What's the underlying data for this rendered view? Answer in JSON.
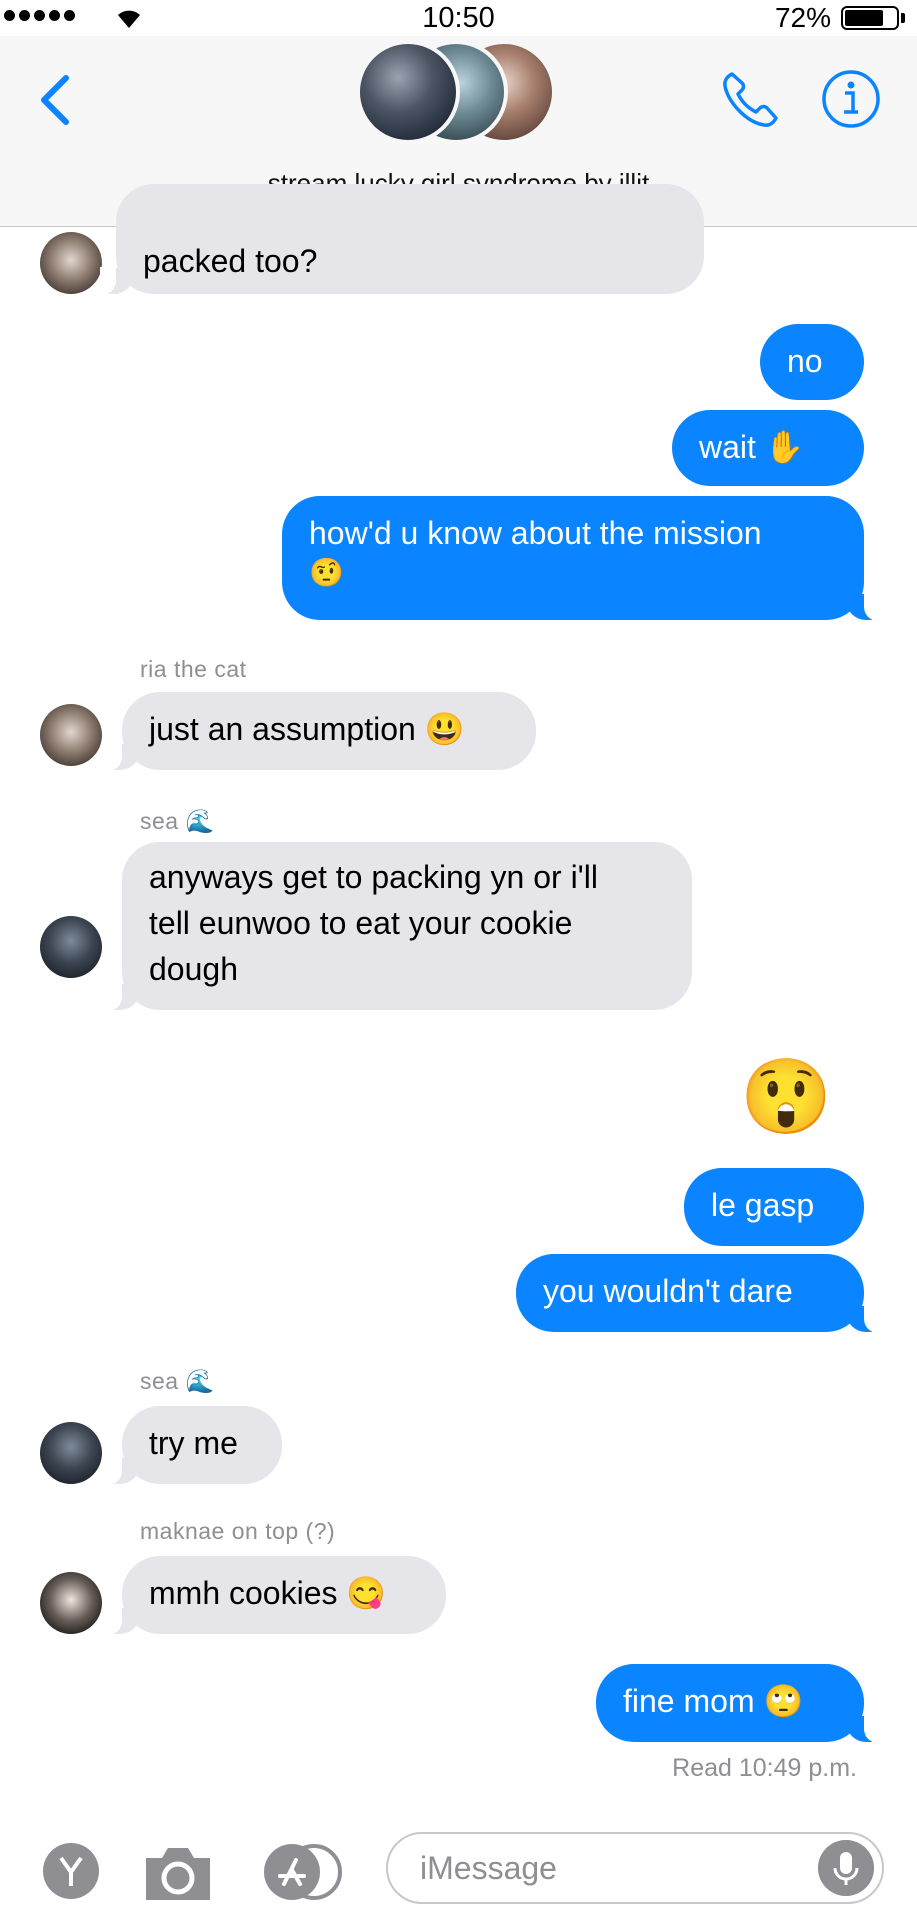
{
  "status_bar": {
    "time": "10:50",
    "battery_percent": "72%"
  },
  "header": {
    "title": "stream lucky girl syndrome by illit"
  },
  "messages": [
    {
      "text": "packed too?"
    },
    {
      "text": "no"
    },
    {
      "text": "wait ✋"
    },
    {
      "line1": "how'd u know about the mission",
      "line2": "🤨"
    },
    {
      "sender": "ria the cat",
      "text": "just an assumption 😃"
    },
    {
      "sender": "sea 🌊",
      "line1": "anyways get to packing yn or i'll",
      "line2": "tell eunwoo to eat your cookie",
      "line3": "dough"
    },
    {
      "text": "😲"
    },
    {
      "text": "le gasp"
    },
    {
      "text": "you wouldn't dare"
    },
    {
      "sender": "sea 🌊",
      "text": "try me"
    },
    {
      "sender": "maknae on top (?)",
      "text": "mmh cookies 😋"
    },
    {
      "text": "fine mom 🙄"
    }
  ],
  "read_receipt": "Read 10:49 p.m.",
  "input": {
    "placeholder": "iMessage"
  },
  "accent_color": "#0a84ff",
  "incoming_color": "#e5e5ea",
  "icons": [
    "back-chevron-icon",
    "phone-icon",
    "info-icon",
    "camera-icon",
    "app-store-icon",
    "microphone-icon"
  ]
}
